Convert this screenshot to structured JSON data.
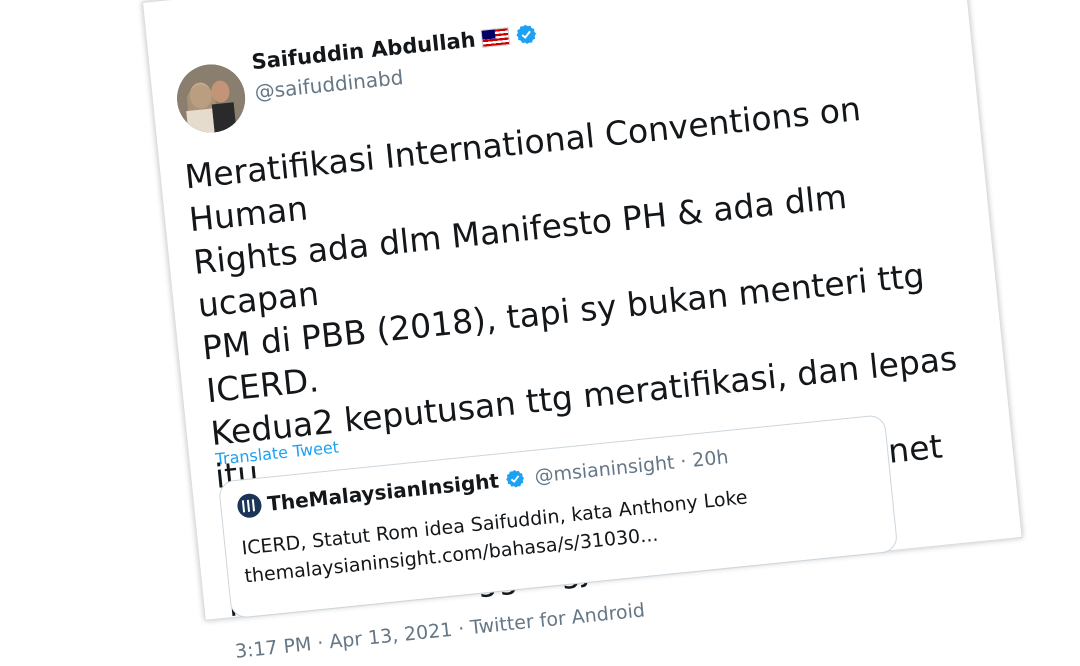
{
  "author": {
    "name": "Saifuddin Abdullah",
    "flag_icon": "malaysia-flag-icon",
    "verified_icon": "verified-badge-icon",
    "handle": "@saifuddinabd"
  },
  "tweet": {
    "text_lines": [
      "Meratifikasi International Conventions on Human",
      "Rights ada dlm Manifesto PH & ada dlm ucapan",
      "PM di PBB (2018), tapi sy bukan menteri ttg ICERD.",
      "Kedua2 keputusan ttg meratifikasi, dan lepas itu",
      "membatalkan Rom Statut, dibuat di Kabinet & sy",
      "menteri bertanggungjawab."
    ],
    "translate_label": "Translate Tweet"
  },
  "quoted": {
    "name": "TheMalaysianInsight",
    "handle_time": "@msianinsight · 20h",
    "line1": "ICERD, Statut Rom idea Saifuddin, kata Anthony Loke",
    "line2": "ICERD, Statut Rom idea Saifuddin, kata Anthony Loke",
    "link_line": "themalaysianinsight.com/bahasa/s/31030..."
  },
  "footer": {
    "time": "3:17 PM",
    "date": "Apr 13, 2021",
    "client": "Twitter for Android"
  },
  "colors": {
    "link": "#1da1f2",
    "text": "#14171a",
    "secondary": "#657786"
  }
}
